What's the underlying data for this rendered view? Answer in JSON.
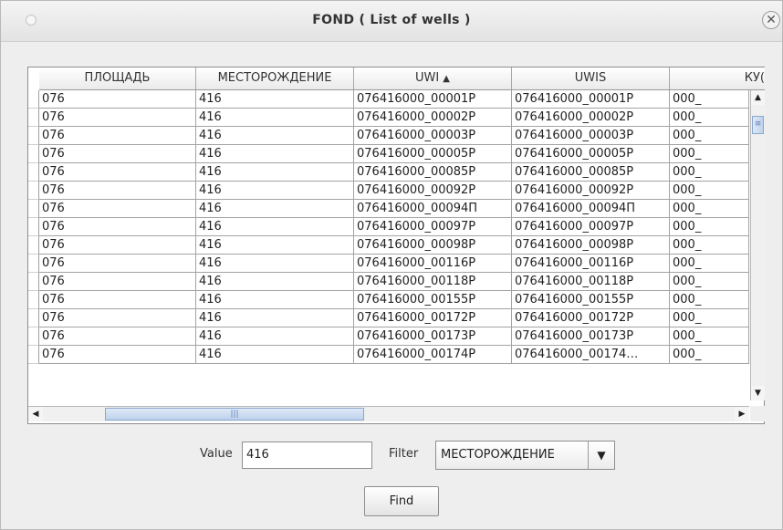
{
  "window": {
    "title": "FOND ( List of wells  )",
    "close_glyph": "✕"
  },
  "table": {
    "columns": [
      {
        "label": "ПЛОЩАДЬ",
        "sort": ""
      },
      {
        "label": "МЕСТОРОЖДЕНИЕ",
        "sort": ""
      },
      {
        "label": "UWI",
        "sort": "▲"
      },
      {
        "label": "UWIS",
        "sort": ""
      },
      {
        "label": "КУ(",
        "sort": ""
      }
    ],
    "rows": [
      [
        "076",
        "416",
        "076416000_00001P",
        "076416000_00001P",
        "000_"
      ],
      [
        "076",
        "416",
        "076416000_00002P",
        "076416000_00002P",
        "000_"
      ],
      [
        "076",
        "416",
        "076416000_00003P",
        "076416000_00003P",
        "000_"
      ],
      [
        "076",
        "416",
        "076416000_00005P",
        "076416000_00005P",
        "000_"
      ],
      [
        "076",
        "416",
        "076416000_00085P",
        "076416000_00085P",
        "000_"
      ],
      [
        "076",
        "416",
        "076416000_00092P",
        "076416000_00092P",
        "000_"
      ],
      [
        "076",
        "416",
        "076416000_00094П",
        "076416000_00094П",
        "000_"
      ],
      [
        "076",
        "416",
        "076416000_00097P",
        "076416000_00097P",
        "000_"
      ],
      [
        "076",
        "416",
        "076416000_00098P",
        "076416000_00098P",
        "000_"
      ],
      [
        "076",
        "416",
        "076416000_00116P",
        "076416000_00116P",
        "000_"
      ],
      [
        "076",
        "416",
        "076416000_00118P",
        "076416000_00118P",
        "000_"
      ],
      [
        "076",
        "416",
        "076416000_00155P",
        "076416000_00155P",
        "000_"
      ],
      [
        "076",
        "416",
        "076416000_00172P",
        "076416000_00172P",
        "000_"
      ],
      [
        "076",
        "416",
        "076416000_00173P",
        "076416000_00173P",
        "000_"
      ],
      [
        "076",
        "416",
        "076416000_00174P",
        "076416000_00174…",
        "000_"
      ]
    ],
    "vscroll": {
      "up": "▲",
      "down": "▼",
      "thumb_grip": "≡",
      "position": 0.05
    },
    "hscroll": {
      "left": "◀",
      "right": "▶",
      "thumb_grip": "|||",
      "position": 0.35
    }
  },
  "form": {
    "value_label": "Value",
    "value": "416",
    "filter_label": "Filter",
    "filter_selected": "МЕСТОРОЖДЕНИЕ",
    "filter_arrow": "▼",
    "find_label": "Find"
  }
}
